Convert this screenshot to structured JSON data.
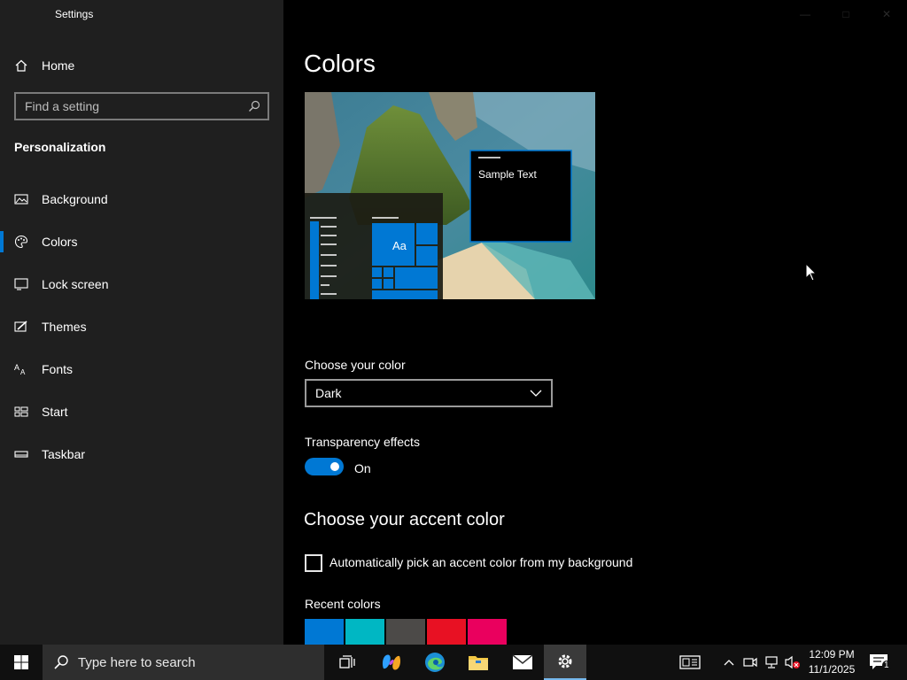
{
  "app": {
    "title": "Settings"
  },
  "sidebar": {
    "home_label": "Home",
    "search_placeholder": "Find a setting",
    "section_title": "Personalization",
    "items": [
      {
        "label": "Background",
        "icon": "picture-icon",
        "selected": false
      },
      {
        "label": "Colors",
        "icon": "palette-icon",
        "selected": true
      },
      {
        "label": "Lock screen",
        "icon": "lock-screen-icon",
        "selected": false
      },
      {
        "label": "Themes",
        "icon": "brush-icon",
        "selected": false
      },
      {
        "label": "Fonts",
        "icon": "fonts-icon",
        "selected": false
      },
      {
        "label": "Start",
        "icon": "start-icon",
        "selected": false
      },
      {
        "label": "Taskbar",
        "icon": "taskbar-icon",
        "selected": false
      }
    ]
  },
  "main": {
    "title": "Colors",
    "preview": {
      "sample_text": "Sample Text",
      "tile_text": "Aa"
    },
    "choose_color_label": "Choose your color",
    "choose_color_value": "Dark",
    "transparency_label": "Transparency effects",
    "transparency_state": "On",
    "accent_heading": "Choose your accent color",
    "auto_accent_label": "Automatically pick an accent color from my background",
    "recent_colors_label": "Recent colors",
    "recent_colors": [
      "#0078d4",
      "#00b7c3",
      "#4c4a48",
      "#e81123",
      "#ea005e"
    ]
  },
  "taskbar": {
    "search_placeholder": "Type here to search",
    "time": "12:09 PM",
    "date": "11/1/2025",
    "notification_count": "1"
  },
  "colors": {
    "accent": "#0078d4",
    "sidebar_bg": "#1f1f1f",
    "main_bg": "#000000"
  }
}
